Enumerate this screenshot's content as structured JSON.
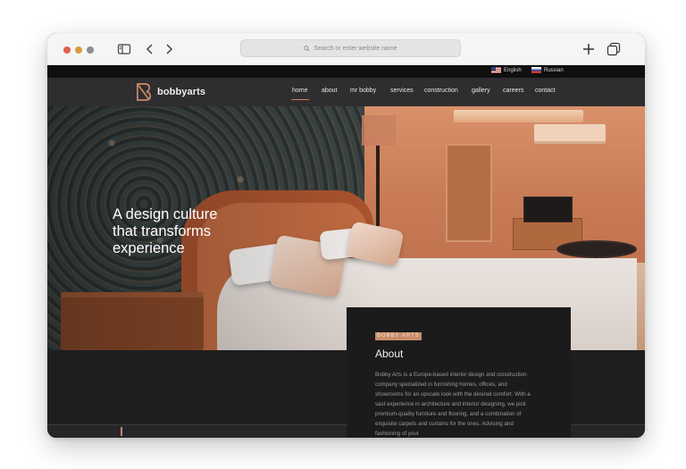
{
  "browser": {
    "url_placeholder": "Search or enter website name"
  },
  "languages": [
    {
      "label": "English"
    },
    {
      "label": "Russian"
    }
  ],
  "site": {
    "logo_text": "bobbyarts",
    "nav": [
      {
        "label": "home",
        "active": true
      },
      {
        "label": "about",
        "active": false
      },
      {
        "label": "mr bobby",
        "active": false
      },
      {
        "label": "services",
        "active": false
      },
      {
        "label": "construction",
        "active": false
      },
      {
        "label": "gallery",
        "active": false
      },
      {
        "label": "careers",
        "active": false
      },
      {
        "label": "contact",
        "active": false
      }
    ]
  },
  "hero": {
    "line1": "A design culture",
    "line2": "that transforms",
    "line3": "experience"
  },
  "about": {
    "tag": "BOBBY ARTS",
    "title": "About",
    "text": "Bobby Arts is a Europe-based interior design and construction company specialized in furnishing homes, offices, and showrooms for an upscale look with the desired comfort. With a vast experience in architecture and interior designing, we pick premium-quality furniture and flooring, and a combination of exquisite carpets and curtains for the ones. Advising and fashioning of your"
  },
  "colors": {
    "accent": "#c98b6a",
    "nav_bg": "#2e2e30",
    "dark_bg": "#1b1b1c"
  }
}
